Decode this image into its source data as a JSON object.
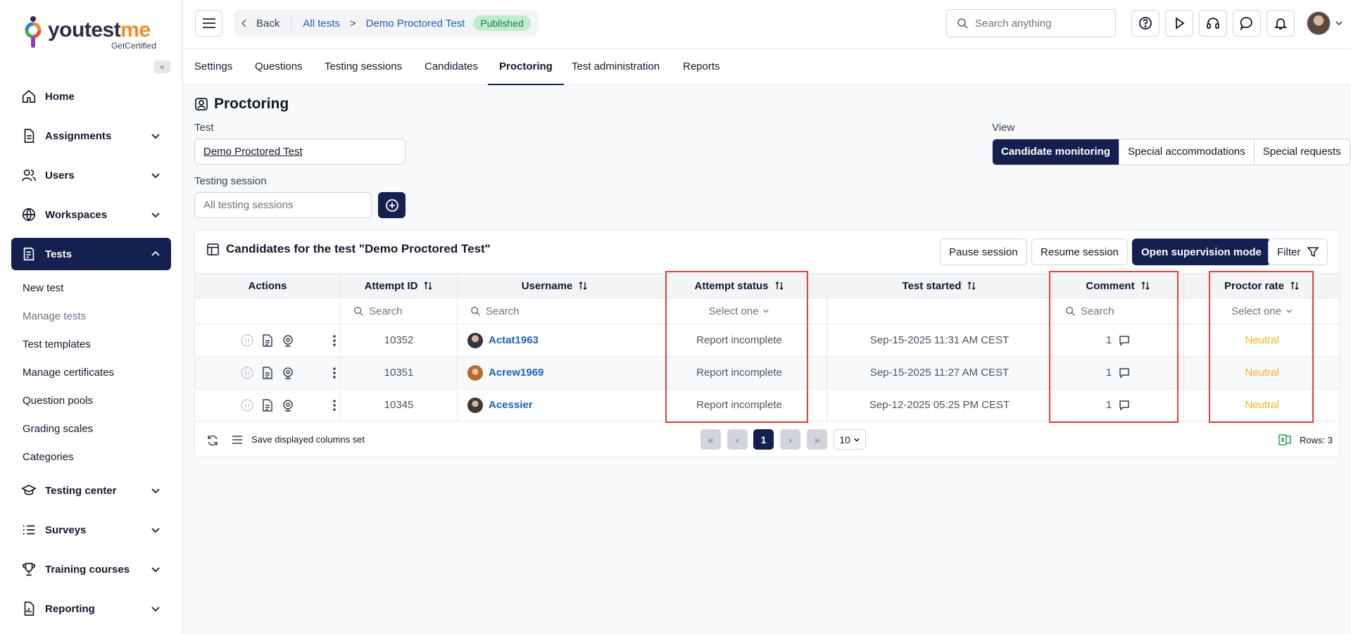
{
  "brand": {
    "name_part1": "youtest",
    "name_part2": "me",
    "subtitle": "GetCertified"
  },
  "sidebar": {
    "items": [
      {
        "label": "Home"
      },
      {
        "label": "Assignments"
      },
      {
        "label": "Users"
      },
      {
        "label": "Workspaces"
      },
      {
        "label": "Tests"
      },
      {
        "label": "Testing center"
      },
      {
        "label": "Surveys"
      },
      {
        "label": "Training courses"
      },
      {
        "label": "Reporting"
      }
    ],
    "tests_sub": [
      "New test",
      "Manage tests",
      "Test templates",
      "Manage certificates",
      "Question pools",
      "Grading scales",
      "Categories"
    ]
  },
  "topbar": {
    "back": "Back",
    "crumb_all_tests": "All tests",
    "crumb_sep": ">",
    "crumb_current": "Demo Proctored Test",
    "status_badge": "Published",
    "search_placeholder": "Search anything"
  },
  "tabs": [
    "Settings",
    "Questions",
    "Testing sessions",
    "Candidates",
    "Proctoring",
    "Test administration",
    "Reports"
  ],
  "page": {
    "title": "Proctoring",
    "test_label": "Test",
    "test_value": "Demo Proctored Test",
    "session_label": "Testing session",
    "session_placeholder": "All testing sessions",
    "view_label": "View",
    "view_options": [
      "Candidate monitoring",
      "Special accommodations",
      "Special requests"
    ]
  },
  "card": {
    "title": "Candidates for the test \"Demo Proctored Test\"",
    "pause": "Pause session",
    "resume": "Resume session",
    "supervision": "Open supervision mode",
    "filter": "Filter"
  },
  "table": {
    "columns": [
      "Actions",
      "Attempt ID",
      "Username",
      "Attempt status",
      "Test started",
      "Comment",
      "Proctor rate"
    ],
    "filters": {
      "search": "Search",
      "select": "Select one"
    },
    "rows": [
      {
        "attempt_id": "10352",
        "username": "Actat1963",
        "status": "Report incomplete",
        "started": "Sep-15-2025 11:31 AM CEST",
        "comment": "1",
        "rate": "Neutral"
      },
      {
        "attempt_id": "10351",
        "username": "Acrew1969",
        "status": "Report incomplete",
        "started": "Sep-15-2025 11:27 AM CEST",
        "comment": "1",
        "rate": "Neutral"
      },
      {
        "attempt_id": "10345",
        "username": "Acessier",
        "status": "Report incomplete",
        "started": "Sep-12-2025 05:25 PM CEST",
        "comment": "1",
        "rate": "Neutral"
      }
    ]
  },
  "footer": {
    "save_columns": "Save displayed columns set",
    "current_page": "1",
    "page_size": "10",
    "rows_info": "Rows: 3"
  },
  "colors": {
    "primary": "#142150",
    "link": "#1f5fbf",
    "neutral": "#f4b41a",
    "highlight": "#e0413a",
    "published_bg": "#bfeccf"
  }
}
